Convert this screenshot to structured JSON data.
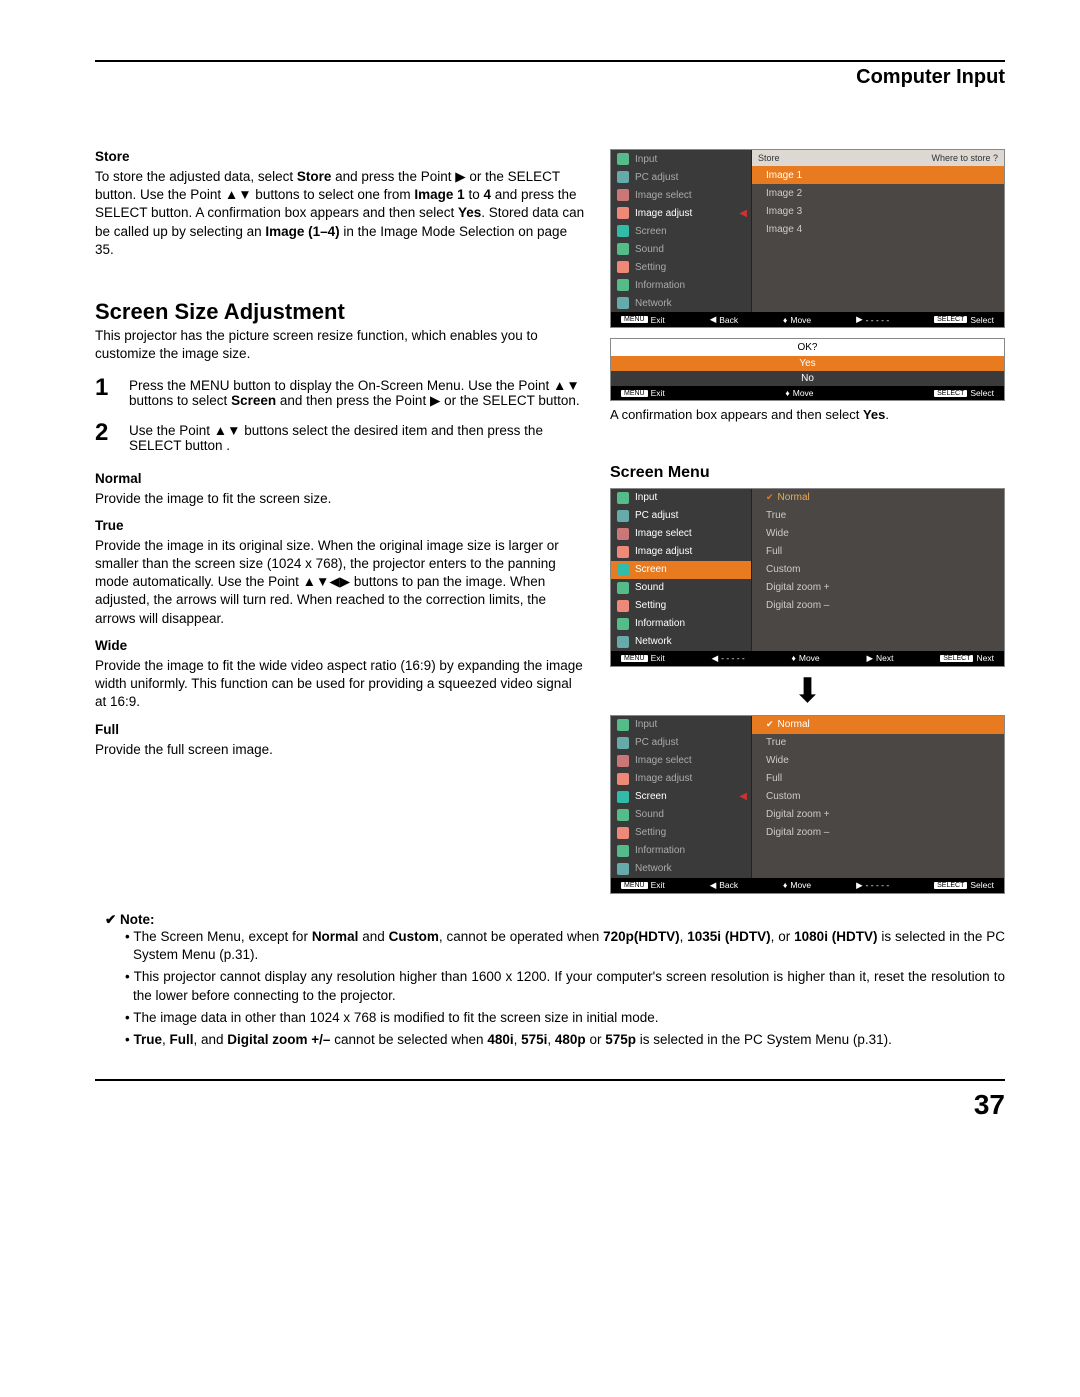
{
  "header": {
    "title": "Computer Input"
  },
  "store": {
    "heading": "Store",
    "para_prefix": "To store the adjusted data, select ",
    "b1": "Store",
    "p1b": " and press the Point ▶ or the SELECT button. Use the Point ▲▼ buttons to select one from ",
    "b2": "Image 1",
    "p1c": " to ",
    "b3": "4",
    "p1d": " and press the SELECT button. A confirmation box appears and then select ",
    "b4": "Yes",
    "p1e": ". Stored data can be called up by selecting an ",
    "b5": "Image (1–4)",
    "p1f": " in the Image Mode Selection on page 35."
  },
  "section": {
    "title": "Screen Size Adjustment",
    "intro": "This projector has the picture screen resize function, which enables you to customize the image size.",
    "step1_a": "Press the MENU button to display the On-Screen Menu. Use the Point ▲▼ buttons to select ",
    "step1_b": "Screen",
    "step1_c": " and then press the Point ▶ or the SELECT button.",
    "step2": "Use the Point ▲▼ buttons select the desired item and then press the SELECT button ."
  },
  "modes": {
    "normal_h": "Normal",
    "normal_t": "Provide the image to fit the screen size.",
    "true_h": "True",
    "true_t": "Provide the image in its original size. When the original image size is larger or smaller than the screen size (1024 x  768), the projector enters to the panning  mode automatically. Use the Point ▲▼◀▶ buttons to pan the image. When adjusted, the arrows will turn red. When reached to the correction limits, the arrows will disappear.",
    "wide_h": "Wide",
    "wide_t": "Provide the image to fit the wide video aspect ratio (16:9) by expanding the image width uniformly. This function can be used for providing a squeezed video signal at 16:9.",
    "full_h": "Full",
    "full_t": "Provide the full screen image."
  },
  "note": {
    "heading": "✔ Note:",
    "n1a": "The Screen Menu, except for ",
    "n1b": "Normal",
    "n1c": " and ",
    "n1d": "Custom",
    "n1e": ", cannot be operated when ",
    "n1f": "720p(HDTV)",
    "n1g": ", ",
    "n1h": "1035i (HDTV)",
    "n1i": ", or ",
    "n1j": "1080i (HDTV)",
    "n1k": "  is selected in the PC System Menu (p.31).",
    "n2": "This projector cannot display any resolution higher than 1600 x 1200. If your computer's screen resolution is higher than it, reset the resolution to the lower before connecting to the projector.",
    "n3": "The image data in other than 1024 x 768 is modified to fit the screen size in initial mode.",
    "n4a": "True",
    "n4b": ", ",
    "n4c": "Full",
    "n4d": ", and ",
    "n4e": "Digital zoom +/–",
    "n4f": " cannot be selected when ",
    "n4g": "480i",
    "n4h": ", ",
    "n4i": "575i",
    "n4j": ", ",
    "n4k": "480p",
    "n4l": " or ",
    "n4m": "575p",
    "n4n": " is selected in the PC System Menu (p.31)."
  },
  "osd1": {
    "header_l": "Store",
    "header_r": "Where to store ?",
    "menu": [
      "Input",
      "PC adjust",
      "Image select",
      "Image adjust",
      "Screen",
      "Sound",
      "Setting",
      "Information",
      "Network"
    ],
    "opts": [
      "Image 1",
      "Image 2",
      "Image 3",
      "Image 4"
    ],
    "foot": {
      "exit": "Exit",
      "back": "Back",
      "move": "Move",
      "next": "- - - - -",
      "select": "Select",
      "menu_badge": "MENU",
      "select_badge": "SELECT"
    }
  },
  "confirm": {
    "q": "OK?",
    "yes": "Yes",
    "no": "No",
    "foot_exit": "Exit",
    "foot_move": "Move",
    "foot_select": "Select"
  },
  "caption1_a": "A confirmation box appears and then select ",
  "caption1_b": "Yes",
  "caption1_c": ".",
  "right_head": "Screen Menu",
  "osd2": {
    "menu": [
      "Input",
      "PC adjust",
      "Image select",
      "Image adjust",
      "Screen",
      "Sound",
      "Setting",
      "Information",
      "Network"
    ],
    "opts": [
      "Normal",
      "True",
      "Wide",
      "Full",
      "Custom",
      "Digital zoom +",
      "Digital zoom –"
    ],
    "foot": {
      "exit": "Exit",
      "back": "- - - - -",
      "move": "Move",
      "next": "Next",
      "select": "Next"
    }
  },
  "osd3": {
    "foot": {
      "exit": "Exit",
      "back": "Back",
      "move": "Move",
      "next": "- - - - -",
      "select": "Select"
    }
  },
  "page_num": "37"
}
